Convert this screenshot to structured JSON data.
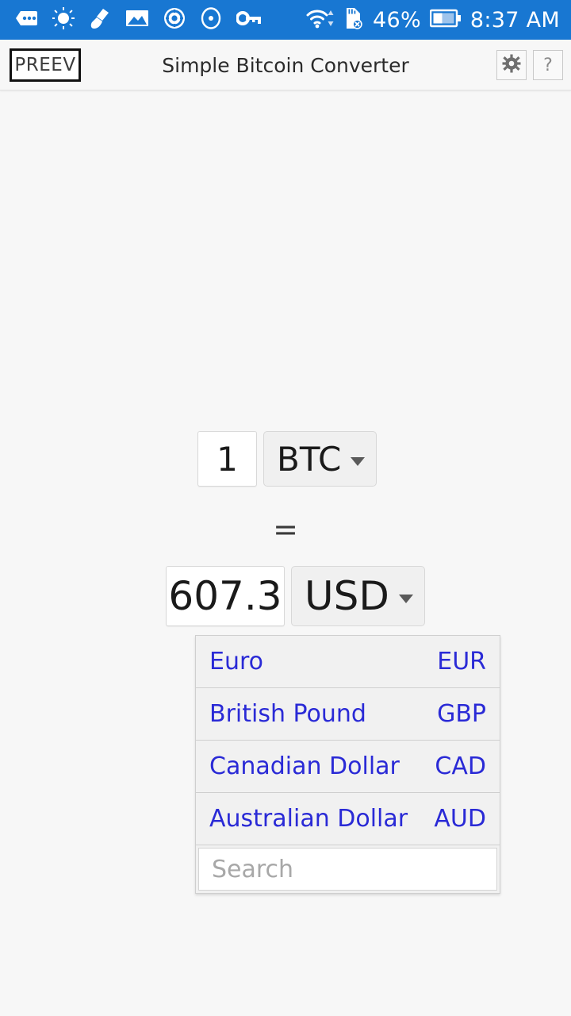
{
  "status_bar": {
    "background_color": "#1877d2",
    "icons": [
      {
        "name": "messages-icon"
      },
      {
        "name": "brightness-night-icon"
      },
      {
        "name": "broom-cleaner-icon"
      },
      {
        "name": "gallery-image-icon"
      },
      {
        "name": "settings-gear-icon"
      },
      {
        "name": "record-dot-icon"
      },
      {
        "name": "vpn-key-icon"
      },
      {
        "name": "wifi-icon"
      },
      {
        "name": "sd-card-missing-icon"
      }
    ],
    "battery_percent": "46%",
    "time": "8:37 AM"
  },
  "header": {
    "brand": "PREEV",
    "title": "Simple Bitcoin Converter",
    "settings_label": "settings-gear",
    "help_label": "?"
  },
  "converter": {
    "from": {
      "amount": "1",
      "currency": "BTC"
    },
    "equals": "=",
    "to": {
      "amount": "607.3",
      "currency": "USD"
    }
  },
  "dropdown": {
    "open": true,
    "link_color": "#2a2ad6",
    "items": [
      {
        "name": "Euro",
        "code": "EUR"
      },
      {
        "name": "British Pound",
        "code": "GBP"
      },
      {
        "name": "Canadian Dollar",
        "code": "CAD"
      },
      {
        "name": "Australian Dollar",
        "code": "AUD"
      }
    ],
    "search_placeholder": "Search"
  }
}
